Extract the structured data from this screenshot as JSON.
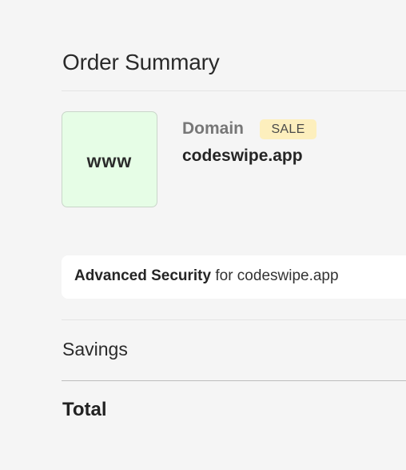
{
  "summary": {
    "title": "Order Summary"
  },
  "item": {
    "icon_text": "www",
    "type": "Domain",
    "badge": "SALE",
    "name": "codeswipe.app"
  },
  "addon": {
    "label_bold": "Advanced Security",
    "label_rest": " for codeswipe.app"
  },
  "savings": {
    "label": "Savings"
  },
  "total": {
    "label": "Total"
  },
  "colors": {
    "background": "#f5f5f5",
    "icon_background": "#e6fde6",
    "badge_background": "#fdefbd",
    "card_background": "#ffffff"
  }
}
